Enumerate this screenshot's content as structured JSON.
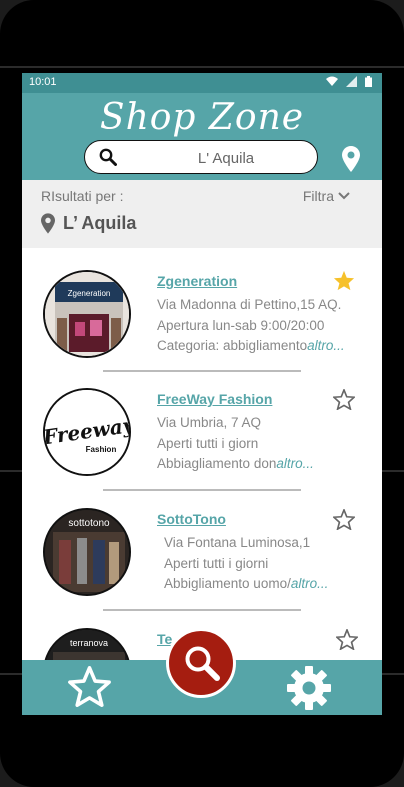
{
  "status_bar": {
    "time": "10:01",
    "icons": [
      "wifi-icon",
      "signal-icon",
      "battery-icon"
    ]
  },
  "header": {
    "title": "Shop Zone",
    "search": {
      "value": "L' Aquila",
      "icon": "search-icon"
    },
    "location_icon": "map-pin-icon"
  },
  "results": {
    "label": "RIsultati per :",
    "filter_label": "Filtra",
    "city": "L’ Aquila"
  },
  "shops": [
    {
      "name": "Zgeneration",
      "address": "Via Madonna di Pettino,15 AQ.",
      "hours": "Apertura lun-sab 9:00/20:00",
      "category": "Categoria: abbigliamento",
      "more": "altro...",
      "favorite": true,
      "logo_text": "Zgeneration"
    },
    {
      "name": "FreeWay Fashion",
      "address": "Via Umbria, 7 AQ",
      "hours": "Aperti tutti i giorn",
      "category": "Abbiagliamento don",
      "more": "altro...",
      "favorite": false,
      "logo_text": "Freeway",
      "logo_sub": "Fashion"
    },
    {
      "name": "SottoTono",
      "address": "Via Fontana Luminosa,1",
      "hours": "Aperti tutti i giorni",
      "category": "Abbigliamento uomo/",
      "more": "altro...",
      "favorite": false,
      "logo_text": "sottotono"
    },
    {
      "name": "Te",
      "favorite": false,
      "logo_text": "terranova"
    }
  ],
  "bottom_nav": {
    "left_icon": "star-icon",
    "center_icon": "search-icon",
    "right_icon": "gear-icon"
  },
  "colors": {
    "accent": "#56a5a8",
    "fab": "#a51d10",
    "favorite": "#f6c12b"
  }
}
